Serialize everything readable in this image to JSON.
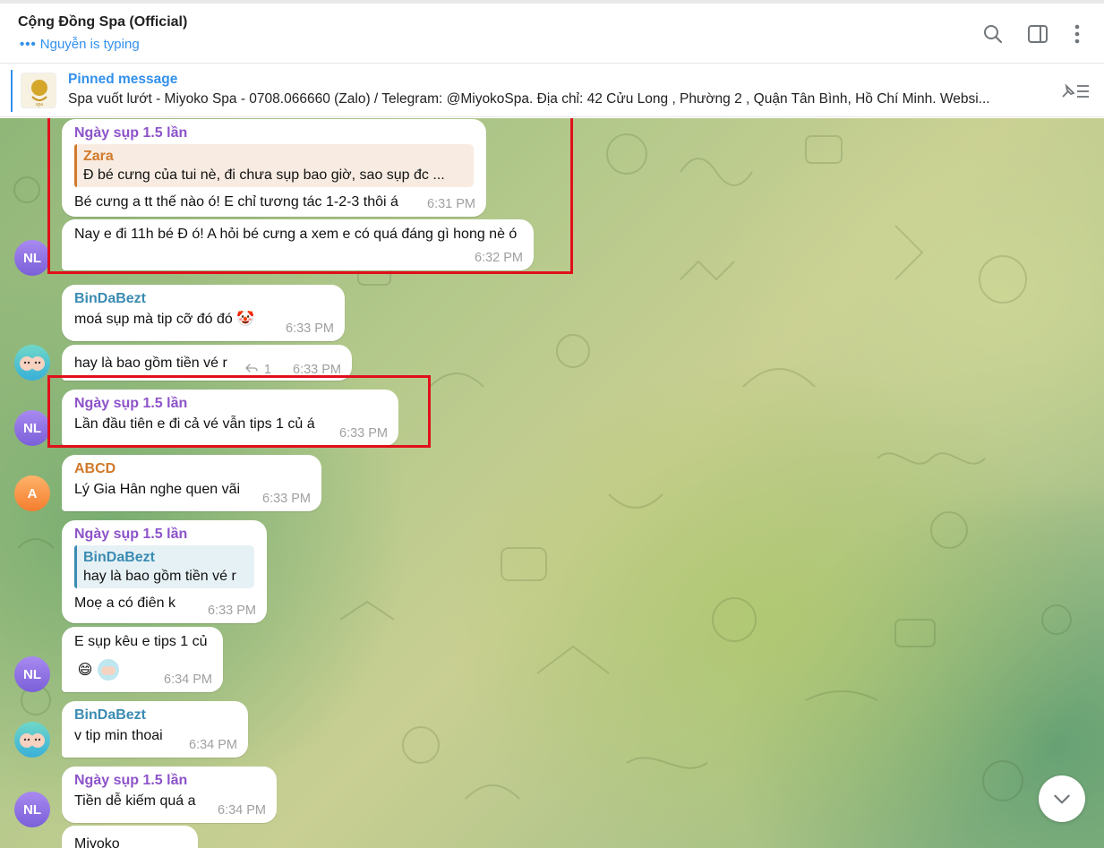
{
  "header": {
    "title": "Cộng Đồng Spa (Official)",
    "typing_dots": "•••",
    "typing_status": "Nguyễn is typing",
    "icons": [
      "search-icon",
      "sidebar-toggle-icon",
      "more-vertical-icon"
    ]
  },
  "pinned": {
    "title": "Pinned message",
    "text": "Spa vuốt lướt  - Miyoko Spa - 0708.066660 (Zalo) / Telegram: @MiyokoSpa.  Địa chỉ: 42 Cửu Long , Phường 2 , Quận Tân Bình, Hồ Chí Minh. Websi..."
  },
  "avatars": {
    "nl": "NL",
    "a": "A"
  },
  "messages": [
    {
      "sender": "Ngày sụp 1.5 lần",
      "reply_name": "Zara",
      "reply_text": "Đ bé cưng của tui nè, đi chưa sụp bao giờ, sao sụp đc ...",
      "text": "Bé cưng a tt thế nào ó! E chỉ tương tác 1-2-3 thôi á",
      "time": "6:31 PM"
    },
    {
      "text": "Nay e đi 11h bé Đ ó! A hỏi bé cưng a xem e có quá đáng gì hong nè ó",
      "time": "6:32 PM"
    },
    {
      "sender": "BinDaBezt",
      "text": "moá sụp mà tip cỡ đó đó 🤡",
      "time": "6:33 PM"
    },
    {
      "text": "hay là bao gồm tiền vé r",
      "reply_count": "1",
      "time": "6:33 PM"
    },
    {
      "sender": "Ngày sụp 1.5 lần",
      "text": "Lần đầu tiên e đi cả vé vẫn tips 1 củ á",
      "time": "6:33 PM"
    },
    {
      "sender": "ABCD",
      "text": "Lý Gia Hân nghe quen vãi",
      "time": "6:33 PM"
    },
    {
      "sender": "Ngày sụp 1.5 lần",
      "reply_name": "BinDaBezt",
      "reply_text": "hay là bao gồm tiền vé r",
      "text": "Moẹ a có điên k",
      "time": "6:33 PM"
    },
    {
      "text": "E sụp kêu e tips 1 củ",
      "reactions": [
        "😄"
      ],
      "time": "6:34 PM"
    },
    {
      "sender": "BinDaBezt",
      "text": "v tip min thoai",
      "time": "6:34 PM"
    },
    {
      "sender": "Ngày sụp 1.5 lần",
      "text": "Tiền dễ kiếm quá a",
      "time": "6:34 PM"
    },
    {
      "text": "Miyoko"
    }
  ]
}
